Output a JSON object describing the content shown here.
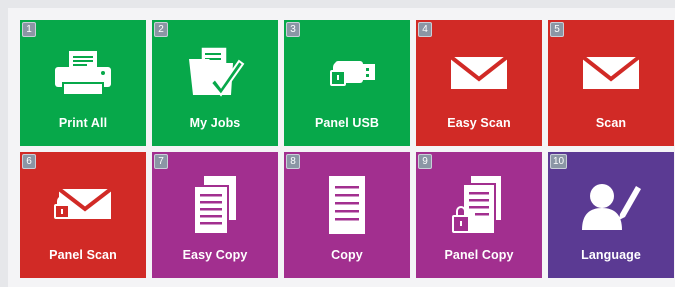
{
  "colors": {
    "green": "#07a84a",
    "red": "#d12a26",
    "purple": "#a22f8f",
    "indigo": "#5b3a93",
    "badge": "#8b96a5"
  },
  "tiles": [
    {
      "number": "1",
      "label": "Print All",
      "icon": "printer-icon",
      "color": "green"
    },
    {
      "number": "2",
      "label": "My Jobs",
      "icon": "folder-check-icon",
      "color": "green"
    },
    {
      "number": "3",
      "label": "Panel USB",
      "icon": "usb-lock-icon",
      "color": "green"
    },
    {
      "number": "4",
      "label": "Easy Scan",
      "icon": "envelope-icon",
      "color": "red"
    },
    {
      "number": "5",
      "label": "Scan",
      "icon": "envelope-icon",
      "color": "red"
    },
    {
      "number": "6",
      "label": "Panel Scan",
      "icon": "envelope-lock-icon",
      "color": "red"
    },
    {
      "number": "7",
      "label": "Easy Copy",
      "icon": "copy-document-icon",
      "color": "purple"
    },
    {
      "number": "8",
      "label": "Copy",
      "icon": "document-icon",
      "color": "purple"
    },
    {
      "number": "9",
      "label": "Panel Copy",
      "icon": "copy-document-lock-icon",
      "color": "purple"
    },
    {
      "number": "10",
      "label": "Language",
      "icon": "user-pen-icon",
      "color": "indigo"
    }
  ]
}
